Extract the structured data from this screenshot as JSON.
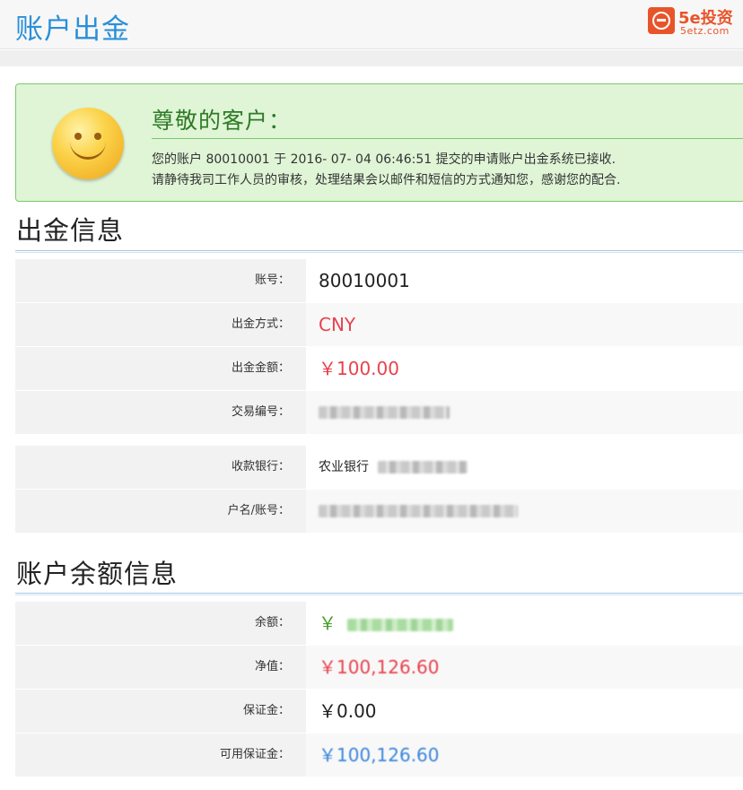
{
  "header": {
    "title": "账户出金",
    "logo": {
      "brand": "5e投资",
      "domain": "5etz.com",
      "color": "#e8542a"
    }
  },
  "notice": {
    "title": "尊敬的客户：",
    "line1": "您的账户 80010001 于 2016- 07- 04 06:46:51 提交的申请账户出金系统已接收.",
    "line2": "请静待我司工作人员的审核，处理结果会以邮件和短信的方式通知您，感谢您的配合.",
    "icon": "smiley-face-icon"
  },
  "withdraw_info": {
    "section_title": "出金信息",
    "rows": [
      {
        "label": "账号：",
        "value": "80010001"
      },
      {
        "label": "出金方式：",
        "value": "CNY"
      },
      {
        "label": "出金金额：",
        "value": "￥100.00"
      },
      {
        "label": "交易编号：",
        "value": ""
      },
      {
        "label": "收款银行：",
        "value": "农业银行"
      },
      {
        "label": "户名/账号：",
        "value": ""
      }
    ]
  },
  "balance_info": {
    "section_title": "账户余额信息",
    "rows": [
      {
        "label": "余额：",
        "value": "￥"
      },
      {
        "label": "净值：",
        "value": "￥100,126.60"
      },
      {
        "label": "保证金：",
        "value": "￥0.00"
      },
      {
        "label": "可用保证金：",
        "value": "￥100,126.60"
      }
    ]
  },
  "colors": {
    "title_blue": "#2a8fd8",
    "red": "#e8424d",
    "green": "#4aa12c",
    "blue": "#3b86dc",
    "notice_bg": "#dff5d6"
  }
}
